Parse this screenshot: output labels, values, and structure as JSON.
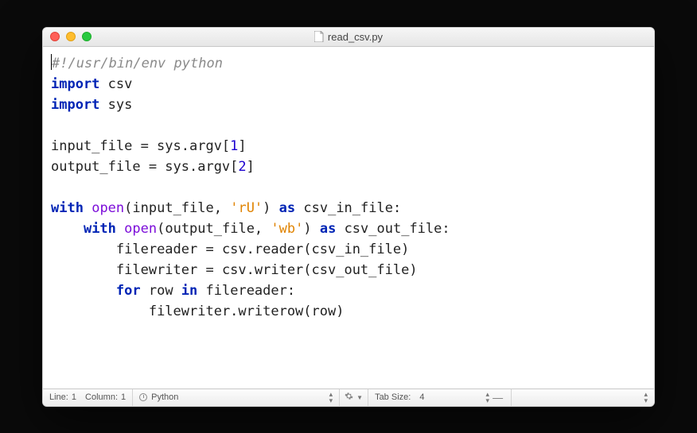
{
  "window": {
    "filename": "read_csv.py"
  },
  "code": {
    "lines": [
      {
        "t": "comment",
        "text": "#!/usr/bin/env python"
      },
      {
        "parts": [
          {
            "t": "keyword",
            "text": "import"
          },
          {
            "t": "plain",
            "text": " csv"
          }
        ]
      },
      {
        "parts": [
          {
            "t": "keyword",
            "text": "import"
          },
          {
            "t": "plain",
            "text": " sys"
          }
        ]
      },
      {
        "empty": true
      },
      {
        "parts": [
          {
            "t": "plain",
            "text": "input_file = sys.argv["
          },
          {
            "t": "number",
            "text": "1"
          },
          {
            "t": "plain",
            "text": "]"
          }
        ]
      },
      {
        "parts": [
          {
            "t": "plain",
            "text": "output_file = sys.argv["
          },
          {
            "t": "number",
            "text": "2"
          },
          {
            "t": "plain",
            "text": "]"
          }
        ]
      },
      {
        "empty": true
      },
      {
        "parts": [
          {
            "t": "keyword",
            "text": "with"
          },
          {
            "t": "plain",
            "text": " "
          },
          {
            "t": "builtin",
            "text": "open"
          },
          {
            "t": "plain",
            "text": "(input_file, "
          },
          {
            "t": "string",
            "text": "'rU'"
          },
          {
            "t": "plain",
            "text": ") "
          },
          {
            "t": "keyword",
            "text": "as"
          },
          {
            "t": "plain",
            "text": " csv_in_file:"
          }
        ]
      },
      {
        "indent": 1,
        "parts": [
          {
            "t": "keyword",
            "text": "with"
          },
          {
            "t": "plain",
            "text": " "
          },
          {
            "t": "builtin",
            "text": "open"
          },
          {
            "t": "plain",
            "text": "(output_file, "
          },
          {
            "t": "string",
            "text": "'wb'"
          },
          {
            "t": "plain",
            "text": ") "
          },
          {
            "t": "keyword",
            "text": "as"
          },
          {
            "t": "plain",
            "text": " csv_out_file:"
          }
        ]
      },
      {
        "indent": 2,
        "parts": [
          {
            "t": "plain",
            "text": "filereader = csv.reader(csv_in_file)"
          }
        ]
      },
      {
        "indent": 2,
        "parts": [
          {
            "t": "plain",
            "text": "filewriter = csv.writer(csv_out_file)"
          }
        ]
      },
      {
        "indent": 2,
        "parts": [
          {
            "t": "keyword",
            "text": "for"
          },
          {
            "t": "plain",
            "text": " row "
          },
          {
            "t": "keyword",
            "text": "in"
          },
          {
            "t": "plain",
            "text": " filereader:"
          }
        ]
      },
      {
        "indent": 3,
        "parts": [
          {
            "t": "plain",
            "text": "filewriter.writerow(row)"
          }
        ]
      }
    ]
  },
  "status": {
    "line_label": "Line:",
    "line_value": "1",
    "column_label": "Column:",
    "column_value": "1",
    "syntax": "Python",
    "tab_label": "Tab Size:",
    "tab_value": "4"
  }
}
